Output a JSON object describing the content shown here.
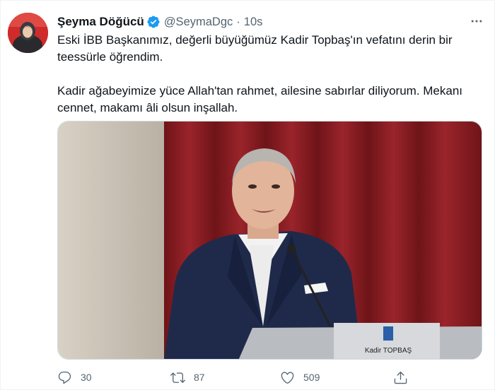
{
  "tweet": {
    "author": {
      "display_name": "Şeyma Döğücü",
      "handle": "@SeymaDgc",
      "verified_icon": "verified-badge-icon",
      "avatar_bg": "#cf2b2b"
    },
    "separator": "·",
    "time": "10s",
    "text": {
      "line1": "Eski İBB Başkanımız, değerli büyüğümüz Kadir Topbaş'ın vefatını derin bir teessürle öğrendim.",
      "line2": "Kadir ağabeyimize yüce Allah'tan rahmet, ailesine sabırlar diliyorum. Mekanı cennet, makamı âli olsun inşallah."
    },
    "media": {
      "podium_label": "Kadir TOPBAŞ",
      "curtain_color": "#8a1c22"
    },
    "actions": {
      "reply_count": "30",
      "retweet_count": "87",
      "like_count": "509"
    },
    "colors": {
      "verified": "#1d9bf0",
      "secondary_text": "#536471"
    }
  }
}
